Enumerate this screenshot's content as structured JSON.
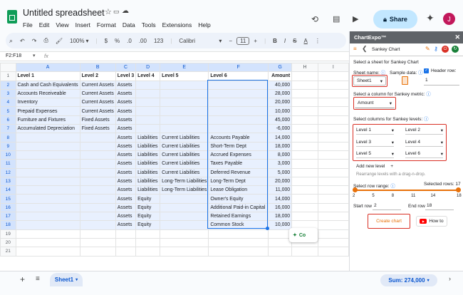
{
  "doc": {
    "title": "Untitled spreadsheet",
    "menu": [
      "File",
      "Edit",
      "View",
      "Insert",
      "Format",
      "Data",
      "Tools",
      "Extensions",
      "Help"
    ],
    "share_label": "Share",
    "avatar_letter": "J"
  },
  "toolbar": {
    "search_label": "Menus",
    "zoom": "100%",
    "currency": "$",
    "percent": "%",
    "dec_less": ".0",
    "dec_more": ".00",
    "num_fmt": "123",
    "font": "Calibri",
    "font_size": "11",
    "bold": "B",
    "italic": "I",
    "strike": "S",
    "text_color": "A"
  },
  "formula": {
    "cell_ref": "F2:F18",
    "fx": "fx"
  },
  "grid": {
    "columns": [
      "A",
      "B",
      "C",
      "D",
      "E",
      "F",
      "G",
      "H",
      "I"
    ],
    "rows": [
      [
        "Level 1",
        "Level 2",
        "Level 3",
        "Level 4",
        "Level 5",
        "Level 6",
        "Amount"
      ],
      [
        "Cash and Cash Equivalents",
        "Current Assets",
        "Assets",
        "",
        "",
        "",
        "40,000"
      ],
      [
        "Accounts Receiveable",
        "Current Assets",
        "Assets",
        "",
        "",
        "",
        "28,000"
      ],
      [
        "Inventory",
        "Current Assets",
        "Assets",
        "",
        "",
        "",
        "20,000"
      ],
      [
        "Prepaid Expenses",
        "Current Assets",
        "Assets",
        "",
        "",
        "",
        "10,000"
      ],
      [
        "Furniture and Fixtures",
        "Fixed Assets",
        "Assets",
        "",
        "",
        "",
        "45,000"
      ],
      [
        "Accumulated Depreciation",
        "Fixed Assets",
        "Assets",
        "",
        "",
        "",
        "-6,000"
      ],
      [
        "",
        "",
        "Assets",
        "Liabilities",
        "Current Liabilities",
        "Accounts Payable",
        "14,000"
      ],
      [
        "",
        "",
        "Assets",
        "Liabilities",
        "Current Liabilities",
        "Short-Term Dept",
        "18,000"
      ],
      [
        "",
        "",
        "Assets",
        "Liabilities",
        "Current Liabilities",
        "Accrued Expenses",
        "8,000"
      ],
      [
        "",
        "",
        "Assets",
        "Liabilities",
        "Current Liabilities",
        "Taxes Payable",
        "3,000"
      ],
      [
        "",
        "",
        "Assets",
        "Liabilities",
        "Current Liabilities",
        "Deferred Revenue",
        "5,000"
      ],
      [
        "",
        "",
        "Assets",
        "Liabilities",
        "Long-Term Liabilities",
        "Long-Term Dept",
        "20,000"
      ],
      [
        "",
        "",
        "Assets",
        "Liabilities",
        "Long-Term Liabilities",
        "Lease Obligation",
        "11,000"
      ],
      [
        "",
        "",
        "Assets",
        "Equity",
        "",
        "Owner's Equity",
        "14,000"
      ],
      [
        "",
        "",
        "Assets",
        "Equity",
        "",
        "Additional Paid-in Capital",
        "16,000"
      ],
      [
        "",
        "",
        "Assets",
        "Equity",
        "",
        "Retained Earnings",
        "18,000"
      ],
      [
        "",
        "",
        "Assets",
        "Equity",
        "",
        "Common Stock",
        "10,000"
      ]
    ],
    "row_numbers": [
      "1",
      "2",
      "3",
      "4",
      "5",
      "6",
      "7",
      "8",
      "9",
      "10",
      "11",
      "12",
      "13",
      "14",
      "15",
      "16",
      "17",
      "18",
      "19",
      "20",
      "21"
    ],
    "explore_label": "Co"
  },
  "bottom": {
    "sheet_name": "Sheet1",
    "sum": "Sum: 274,000"
  },
  "panel": {
    "title": "ChartExpo™",
    "chart_name": "Sankey Chart",
    "select_sheet_label": "Select a sheet for Sankey Chart",
    "sheet_name_label": "Sheet name:",
    "sample_data_label": "Sample data:",
    "header_row_label": "Header row:",
    "sheet_value": "Sheet1",
    "header_row_value": "1",
    "metric_label": "Select a column for Sankey metric:",
    "metric_value": "Amount",
    "levels_label": "Select columns for Sankey levels:",
    "levels": [
      "Level 1",
      "Level 2",
      "Level 3",
      "Level 4",
      "Level 5",
      "Level 6"
    ],
    "add_level": "Add new level",
    "add_level_plus": "+",
    "rearrange": "Rearrange levels with a drag-n-drop.",
    "row_range_label": "Select row range:",
    "selected_rows": "Selected rows: 17",
    "range_ticks": [
      "2",
      "5",
      "8",
      "11",
      "14",
      "18"
    ],
    "range_fraction": [
      0,
      1
    ],
    "start_row_label": "Start row",
    "start_row": "2",
    "end_row_label": "End row",
    "end_row": "18",
    "create_chart": "Create chart",
    "how_to": "How to"
  },
  "colors": {
    "accent": "#0b57d0",
    "red": "#d93025",
    "orange": "#e8710a",
    "selection": "#e8f0fe"
  }
}
